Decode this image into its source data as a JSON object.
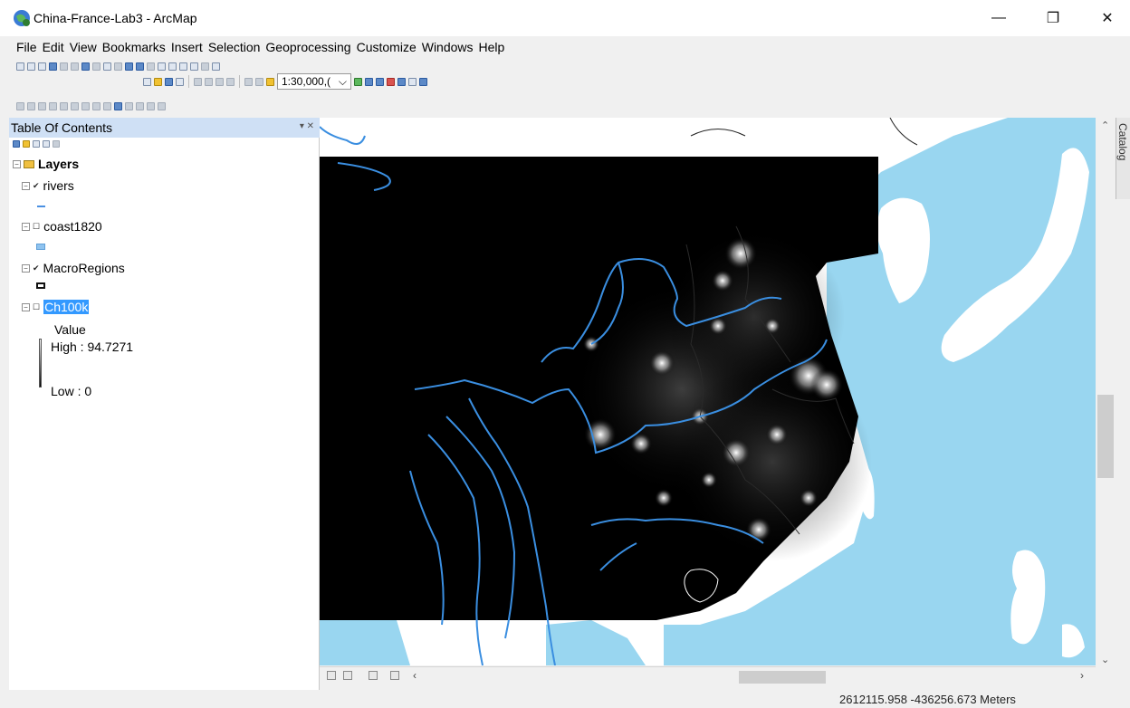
{
  "window": {
    "title": "China-France-Lab3 - ArcMap",
    "minimize_glyph": "—",
    "maximize_glyph": "❐",
    "close_glyph": "✕"
  },
  "menu": [
    "File",
    "Edit",
    "View",
    "Bookmarks",
    "Insert",
    "Selection",
    "Geoprocessing",
    "Customize",
    "Windows",
    "Help"
  ],
  "toolbar": {
    "scale_value": "1:30,000,(",
    "scale_dropdown_glyph": "⌵"
  },
  "toc": {
    "title": "Table Of Contents",
    "pin_glyph": "▾ ✕",
    "root_label": "Layers",
    "layers": [
      {
        "name": "rivers",
        "expander": "⊟",
        "check": "✔"
      },
      {
        "name": "coast1820",
        "expander": "⊟",
        "check": "☐"
      },
      {
        "name": "MacroRegions",
        "expander": "⊟",
        "check": "✔"
      },
      {
        "name": "Ch100k",
        "expander": "⊟",
        "check": "☐"
      }
    ],
    "legend_value_label": "Value",
    "legend_high": "High : 94.7271",
    "legend_low": "Low : 0"
  },
  "catalog_tab_label": "Catalog",
  "scroll": {
    "up": "⌃",
    "down": "⌄",
    "left": "‹",
    "right": "›"
  },
  "status": {
    "coordinates": "2612115.958  -436256.673 Meters"
  },
  "colors": {
    "water": "#99d6f0",
    "land": "#ffffff",
    "raster_bg": "#000000",
    "rivers": "#3a8ee0",
    "selection": "#3399ff"
  }
}
